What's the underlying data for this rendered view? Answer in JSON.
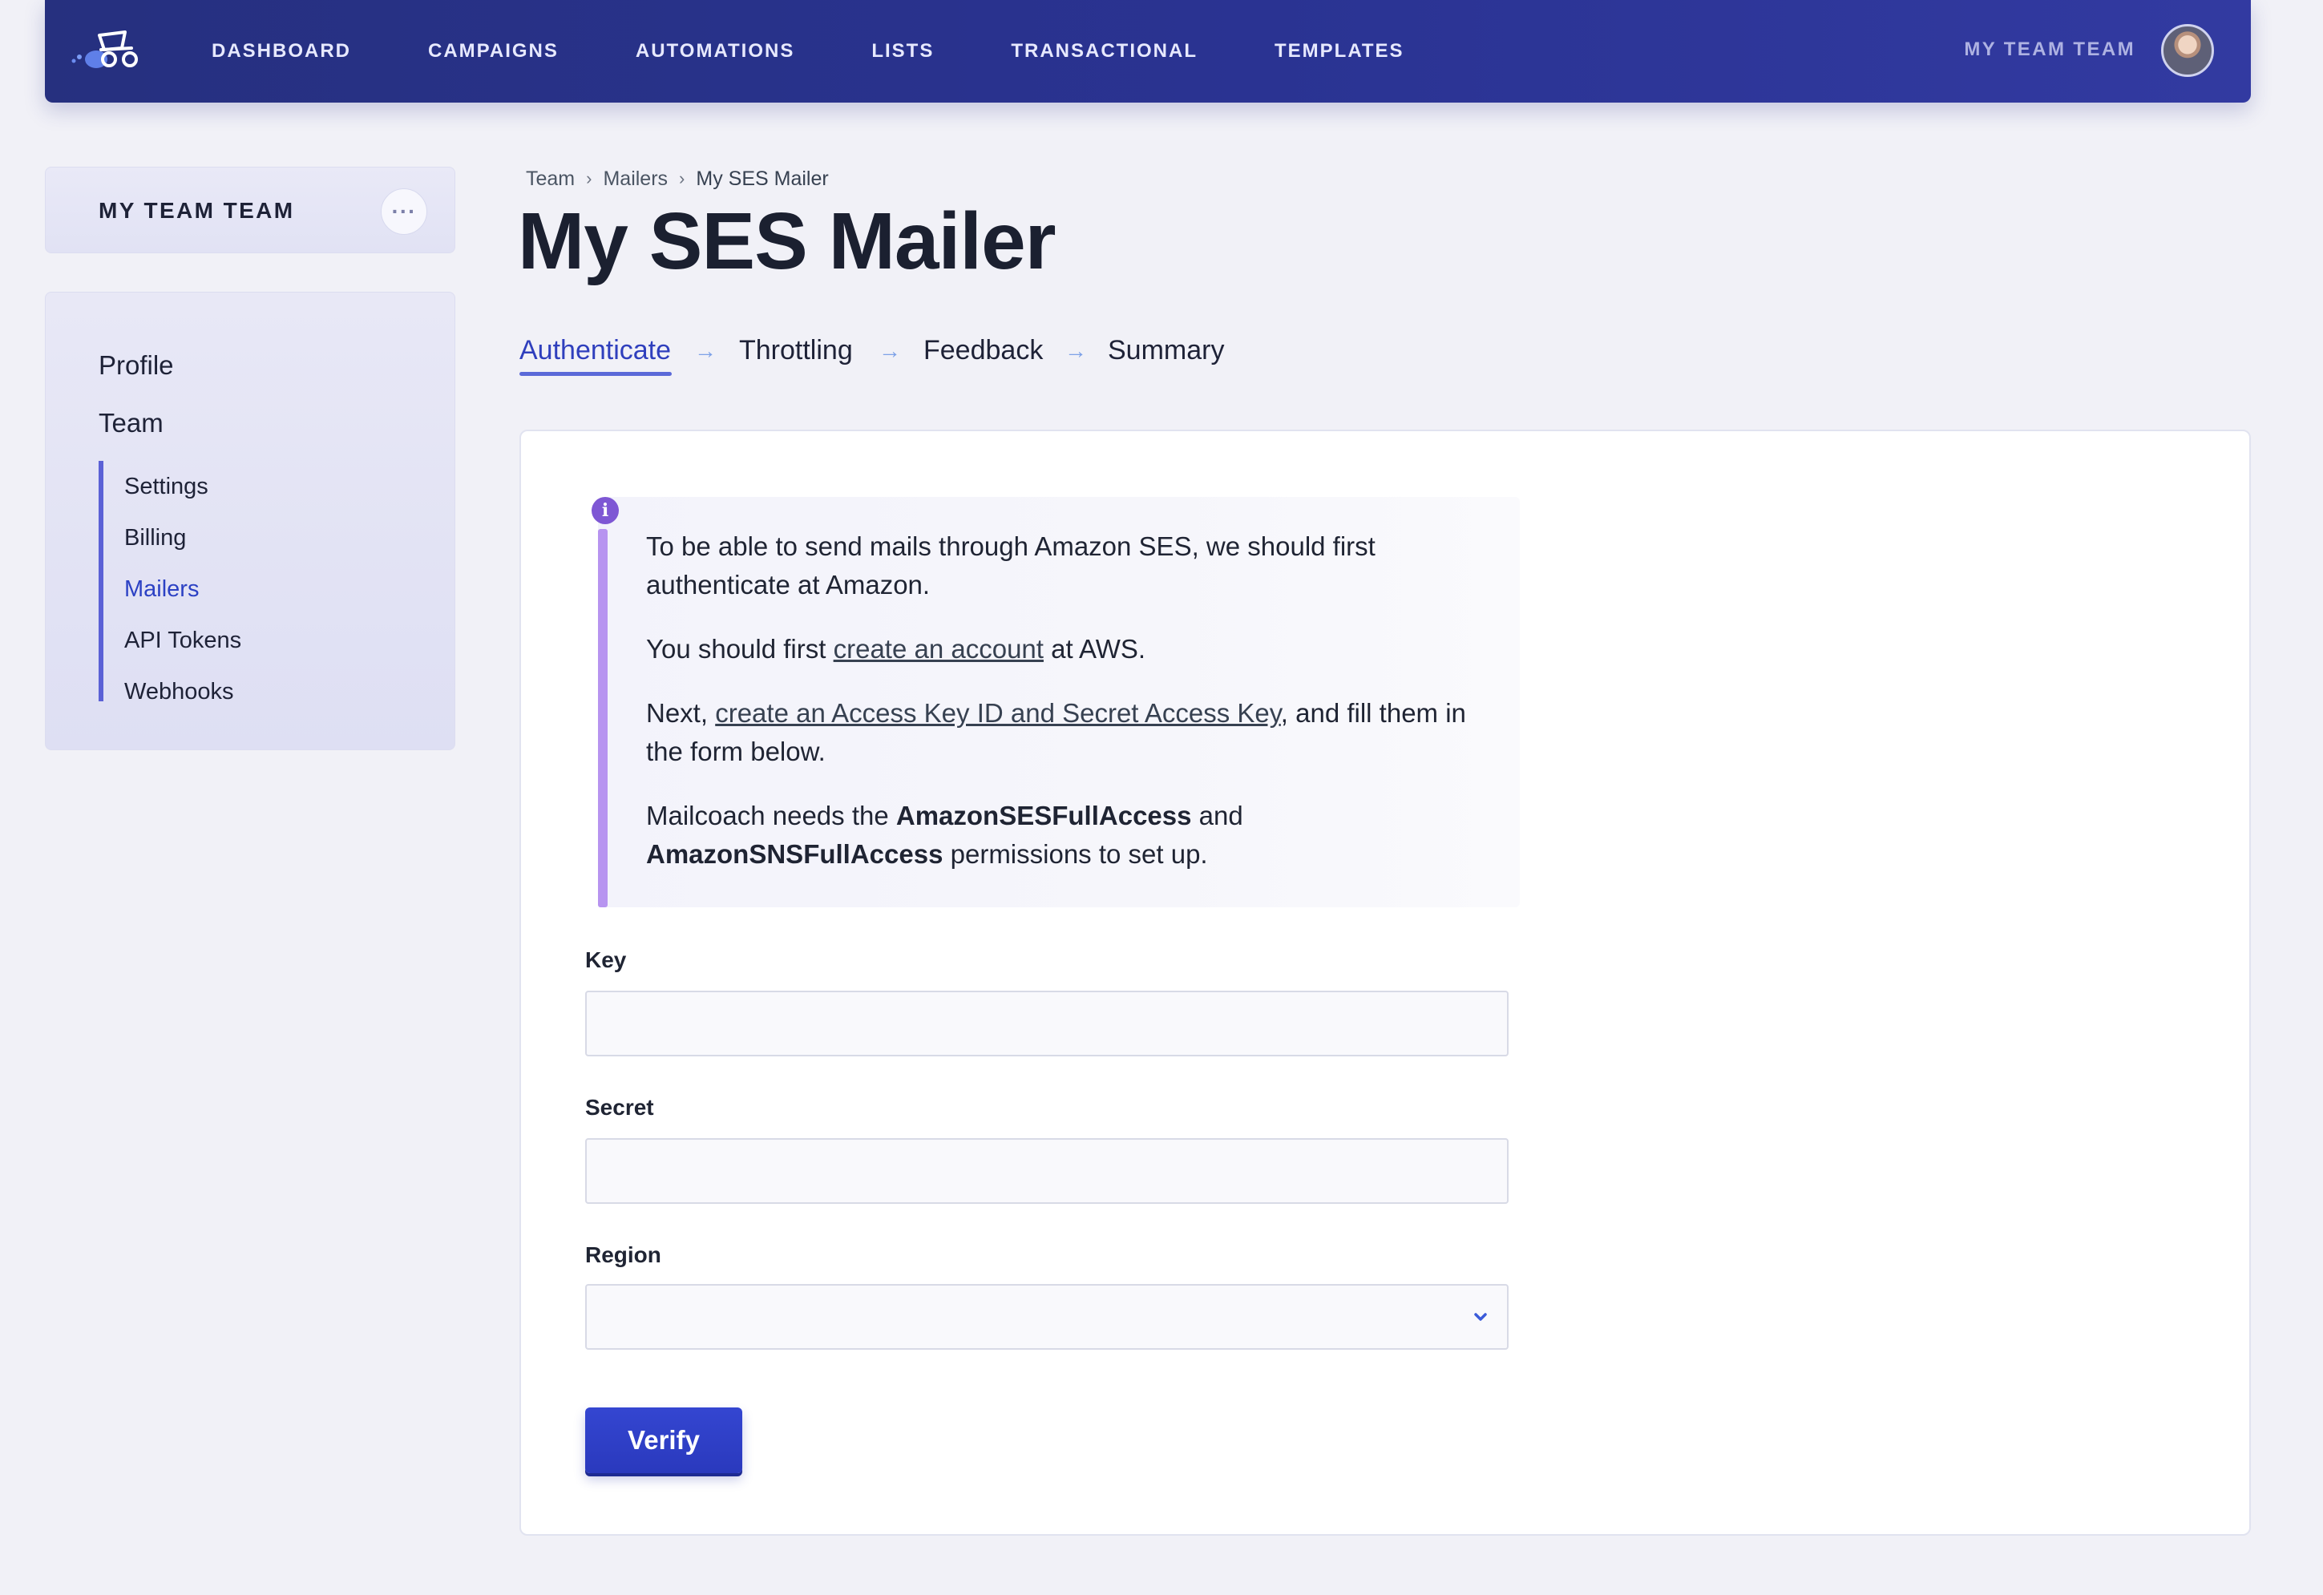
{
  "nav": {
    "items": [
      "DASHBOARD",
      "CAMPAIGNS",
      "AUTOMATIONS",
      "LISTS",
      "TRANSACTIONAL",
      "TEMPLATES"
    ],
    "team_name": "MY TEAM TEAM"
  },
  "sidebar": {
    "team_card_title": "MY TEAM TEAM",
    "more_label": "···",
    "top_items": [
      "Profile",
      "Team"
    ],
    "sub_items": [
      "Settings",
      "Billing",
      "Mailers",
      "API Tokens",
      "Webhooks"
    ],
    "active_sub_item": "Mailers"
  },
  "breadcrumb": [
    "Team",
    "Mailers",
    "My SES Mailer"
  ],
  "page_title": "My SES Mailer",
  "steps": {
    "items": [
      "Authenticate",
      "Throttling",
      "Feedback",
      "Summary"
    ],
    "active": "Authenticate"
  },
  "info": {
    "p1": "To be able to send mails through Amazon SES, we should first authenticate at Amazon.",
    "p2_before": "You should first ",
    "p2_link": "create an account",
    "p2_after": " at AWS.",
    "p3_before": "Next, ",
    "p3_link": "create an Access Key ID and Secret Access Key",
    "p3_after": ", and fill them in the form below.",
    "p4_a": "Mailcoach needs the ",
    "p4_b": "AmazonSESFullAccess",
    "p4_c": " and ",
    "p4_d": "AmazonSNSFullAccess",
    "p4_e": " permissions to set up."
  },
  "form": {
    "key_label": "Key",
    "key_value": "",
    "secret_label": "Secret",
    "secret_value": "",
    "region_label": "Region",
    "region_value": "",
    "verify_label": "Verify"
  },
  "colors": {
    "accent": "#2c41c4",
    "nav_bg": "#2a3392",
    "info_bar": "#b794f0",
    "info_icon": "#7e57d4",
    "button": "#2f3fc6"
  },
  "icons": [
    "mailcoach-logo-icon",
    "chevron-right-icon",
    "arrow-right-icon",
    "info-icon",
    "chevron-down-icon",
    "more-dots-icon"
  ]
}
